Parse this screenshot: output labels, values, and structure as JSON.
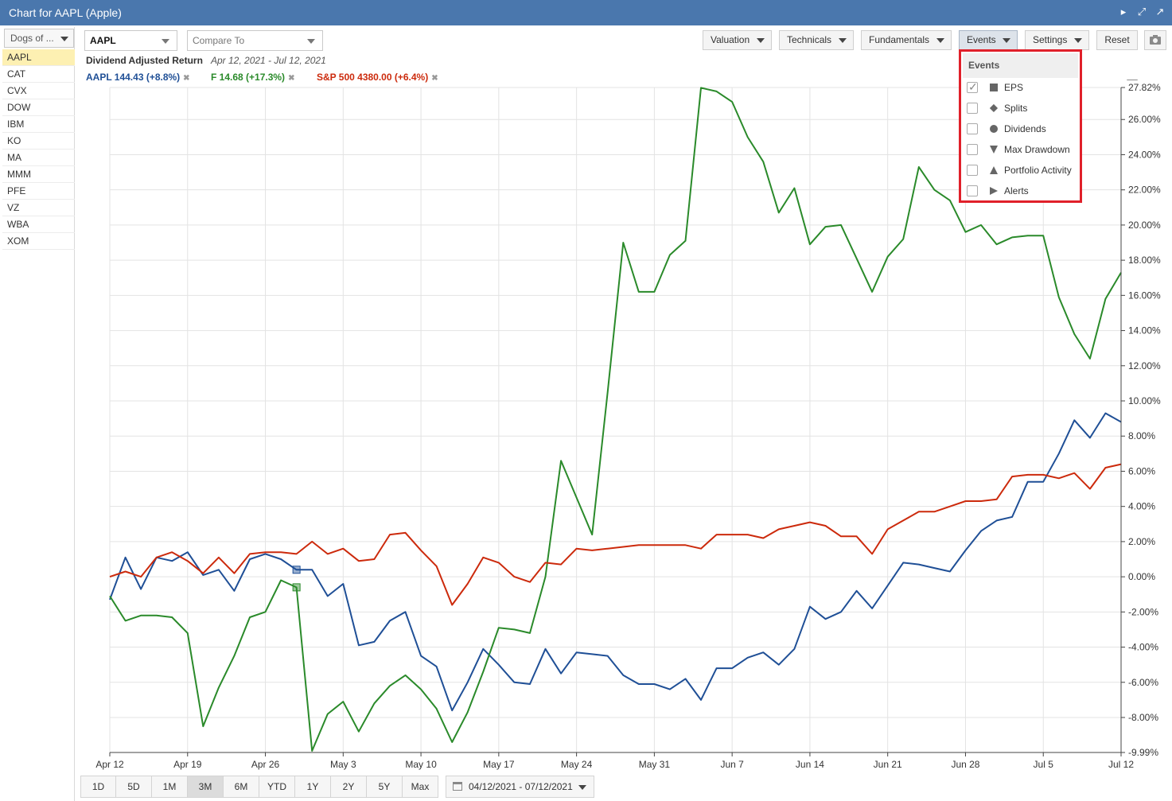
{
  "window": {
    "title": "Chart for AAPL (Apple)"
  },
  "sidebar": {
    "list_label": "Dogs of ...",
    "tickers": [
      "AAPL",
      "CAT",
      "CVX",
      "DOW",
      "IBM",
      "KO",
      "MA",
      "MMM",
      "PFE",
      "VZ",
      "WBA",
      "XOM"
    ],
    "active": "AAPL"
  },
  "toolbar": {
    "symbol": "AAPL",
    "compare_placeholder": "Compare To",
    "valuation": "Valuation",
    "technicals": "Technicals",
    "fundamentals": "Fundamentals",
    "events": "Events",
    "settings": "Settings",
    "reset": "Reset"
  },
  "chart_header": {
    "label": "Dividend Adjusted Return",
    "date_range": "Apr 12, 2021 - Jul 12, 2021",
    "legend": [
      {
        "text": "AAPL 144.43 (+8.8%)",
        "color": "#1f4f96"
      },
      {
        "text": "F 14.68 (+17.3%)",
        "color": "#2a8a2a"
      },
      {
        "text": "S&P 500 4380.00 (+6.4%)",
        "color": "#cc2a0c"
      }
    ]
  },
  "events_menu": {
    "title": "Events",
    "items": [
      {
        "label": "EPS",
        "icon": "square-icon",
        "checked": true
      },
      {
        "label": "Splits",
        "icon": "diamond-icon",
        "checked": false
      },
      {
        "label": "Dividends",
        "icon": "circle-icon",
        "checked": false
      },
      {
        "label": "Max Drawdown",
        "icon": "triangle-down-icon",
        "checked": false
      },
      {
        "label": "Portfolio Activity",
        "icon": "triangle-up-icon",
        "checked": false
      },
      {
        "label": "Alerts",
        "icon": "triangle-right-icon",
        "checked": false
      }
    ]
  },
  "range_buttons": [
    "1D",
    "5D",
    "1M",
    "3M",
    "6M",
    "YTD",
    "1Y",
    "2Y",
    "5Y",
    "Max"
  ],
  "active_range": "3M",
  "date_picker": "04/12/2021 - 07/12/2021",
  "chart_data": {
    "type": "line",
    "x_tick_labels": [
      "Apr 12",
      "Apr 19",
      "Apr 26",
      "May 3",
      "May 10",
      "May 17",
      "May 24",
      "May 31",
      "Jun 7",
      "Jun 14",
      "Jun 21",
      "Jun 28",
      "Jul 5",
      "Jul 12"
    ],
    "y_tick_labels": [
      "27.82%",
      "26.00%",
      "24.00%",
      "22.00%",
      "20.00%",
      "18.00%",
      "16.00%",
      "14.00%",
      "12.00%",
      "10.00%",
      "8.00%",
      "6.00%",
      "4.00%",
      "2.00%",
      "0.00%",
      "-2.00%",
      "-4.00%",
      "-6.00%",
      "-8.00%",
      "-9.99%"
    ],
    "ylim": [
      -9.99,
      27.82
    ],
    "series": [
      {
        "name": "AAPL",
        "color": "#1f4f96",
        "values": [
          -1.3,
          1.1,
          -0.7,
          1.1,
          0.9,
          1.4,
          0.1,
          0.4,
          -0.8,
          1.0,
          1.3,
          1.0,
          0.4,
          0.4,
          -1.1,
          -0.4,
          -3.9,
          -3.7,
          -2.5,
          -2.0,
          -4.5,
          -5.1,
          -7.6,
          -6.0,
          -4.1,
          -5.0,
          -6.0,
          -6.1,
          -4.1,
          -5.5,
          -4.3,
          -4.4,
          -4.5,
          -5.6,
          -6.1,
          -6.1,
          -6.4,
          -5.8,
          -7.0,
          -5.2,
          -5.2,
          -4.6,
          -4.3,
          -5.0,
          -4.1,
          -1.7,
          -2.4,
          -2.0,
          -0.8,
          -1.8,
          -0.5,
          0.8,
          0.7,
          0.5,
          0.3,
          1.5,
          2.6,
          3.2,
          3.4,
          5.4,
          5.4,
          7.0,
          8.9,
          7.9,
          9.3,
          8.8
        ]
      },
      {
        "name": "F",
        "color": "#2a8a2a",
        "values": [
          -1.1,
          -2.5,
          -2.2,
          -2.2,
          -2.3,
          -3.2,
          -8.5,
          -6.3,
          -4.5,
          -2.3,
          -2.0,
          -0.2,
          -0.6,
          -9.9,
          -7.8,
          -7.1,
          -8.8,
          -7.2,
          -6.2,
          -5.6,
          -6.4,
          -7.5,
          -9.4,
          -7.7,
          -5.4,
          -2.9,
          -3.0,
          -3.2,
          0.0,
          6.6,
          4.5,
          2.4,
          10.5,
          19.0,
          16.2,
          16.2,
          18.3,
          19.1,
          27.8,
          27.6,
          27.0,
          25.0,
          23.6,
          20.7,
          22.1,
          18.9,
          19.9,
          20.0,
          18.1,
          16.2,
          18.2,
          19.2,
          23.3,
          22.0,
          21.4,
          19.6,
          20.0,
          18.9,
          19.3,
          19.4,
          19.4,
          15.9,
          13.8,
          12.4,
          15.8,
          17.3
        ]
      },
      {
        "name": "S&P 500",
        "color": "#cc2a0c",
        "values": [
          0.0,
          0.3,
          0.0,
          1.1,
          1.4,
          0.9,
          0.2,
          1.1,
          0.2,
          1.3,
          1.4,
          1.4,
          1.3,
          2.0,
          1.3,
          1.6,
          0.9,
          1.0,
          2.4,
          2.5,
          1.5,
          0.6,
          -1.6,
          -0.4,
          1.1,
          0.8,
          0.0,
          -0.3,
          0.8,
          0.7,
          1.6,
          1.5,
          1.6,
          1.7,
          1.8,
          1.8,
          1.8,
          1.8,
          1.6,
          2.4,
          2.4,
          2.4,
          2.2,
          2.7,
          2.9,
          3.1,
          2.9,
          2.3,
          2.3,
          1.3,
          2.7,
          3.2,
          3.7,
          3.7,
          4.0,
          4.3,
          4.3,
          4.4,
          5.7,
          5.8,
          5.8,
          5.6,
          5.9,
          5.0,
          6.2,
          6.4
        ]
      }
    ]
  }
}
